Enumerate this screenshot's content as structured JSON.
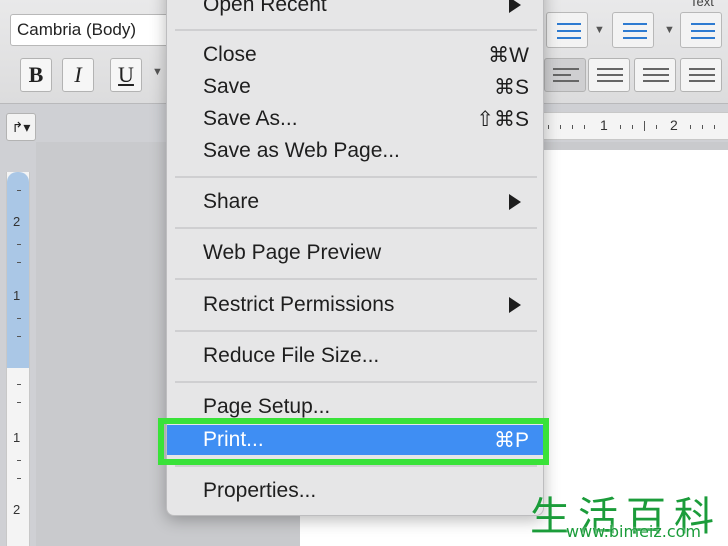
{
  "ribbon": {
    "font_name": "Cambria (Body)",
    "bold_label": "B",
    "italic_label": "I",
    "underline_label": "U",
    "styles_label": "Text"
  },
  "rulers": {
    "horizontal_numbers": [
      "1",
      "2"
    ],
    "vertical_numbers": [
      "2",
      "1",
      "1",
      "2"
    ]
  },
  "menu": {
    "items": [
      {
        "label": "Open Recent",
        "shortcut": "",
        "submenu": true
      },
      {
        "label": "Close",
        "shortcut": "⌘W",
        "submenu": false
      },
      {
        "label": "Save",
        "shortcut": "⌘S",
        "submenu": false
      },
      {
        "label": "Save As...",
        "shortcut": "⇧⌘S",
        "submenu": false
      },
      {
        "label": "Save as Web Page...",
        "shortcut": "",
        "submenu": false
      },
      {
        "label": "Share",
        "shortcut": "",
        "submenu": true
      },
      {
        "label": "Web Page Preview",
        "shortcut": "",
        "submenu": false
      },
      {
        "label": "Restrict Permissions",
        "shortcut": "",
        "submenu": true
      },
      {
        "label": "Reduce File Size...",
        "shortcut": "",
        "submenu": false
      },
      {
        "label": "Page Setup...",
        "shortcut": "",
        "submenu": false
      },
      {
        "label": "Print...",
        "shortcut": "⌘P",
        "submenu": false,
        "selected": true
      },
      {
        "label": "Properties...",
        "shortcut": "",
        "submenu": false
      }
    ]
  },
  "colors": {
    "selection": "#3f8ef3",
    "highlight_outline": "#39e239",
    "watermark": "#1b9c3a"
  },
  "watermark": {
    "chinese": "生活百科",
    "url": "www.bimeiz.com"
  }
}
